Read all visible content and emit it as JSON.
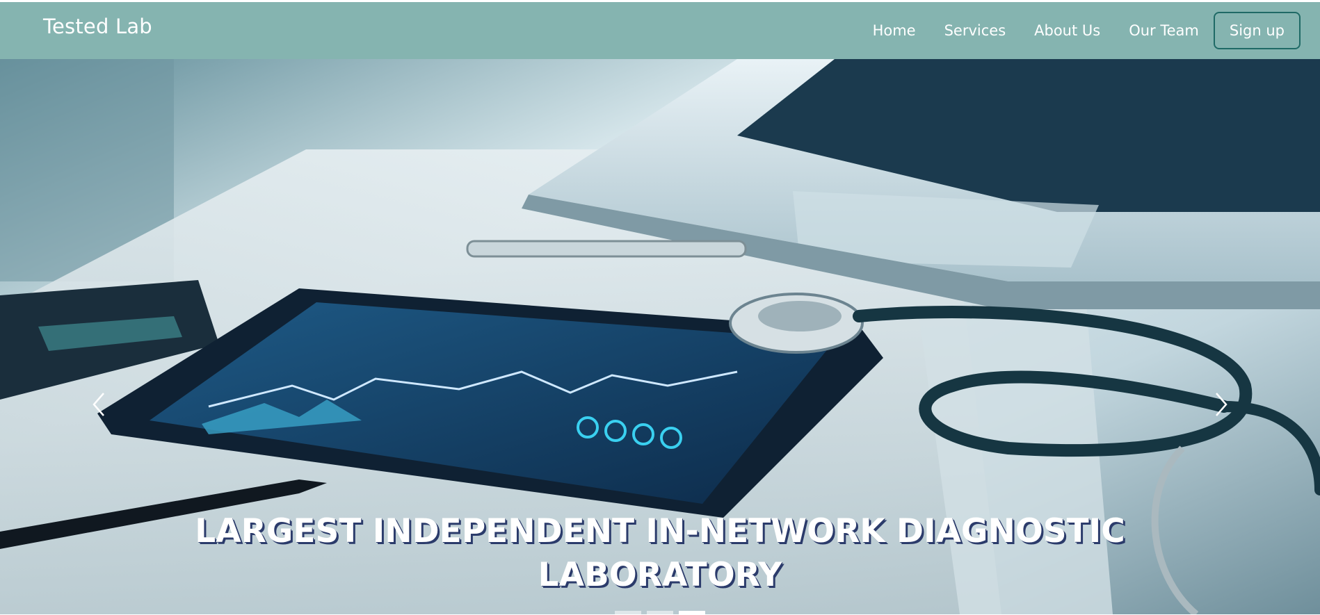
{
  "navbar": {
    "brand": "Tested Lab",
    "links": [
      "Home",
      "Services",
      "About Us",
      "Our Team"
    ],
    "signup_label": "Sign up"
  },
  "hero": {
    "title_line1": "LARGEST INDEPENDENT IN-NETWORK DIAGNOSTIC",
    "title_line2": "LABORATORY",
    "image_description_icon": "medical-desk-photo",
    "active_slide": 3,
    "slide_count": 3
  },
  "colors": {
    "navbar_bg": "#85b4b0",
    "signup_border": "#1f6a66",
    "title_shadow": "#2b3b6b"
  }
}
